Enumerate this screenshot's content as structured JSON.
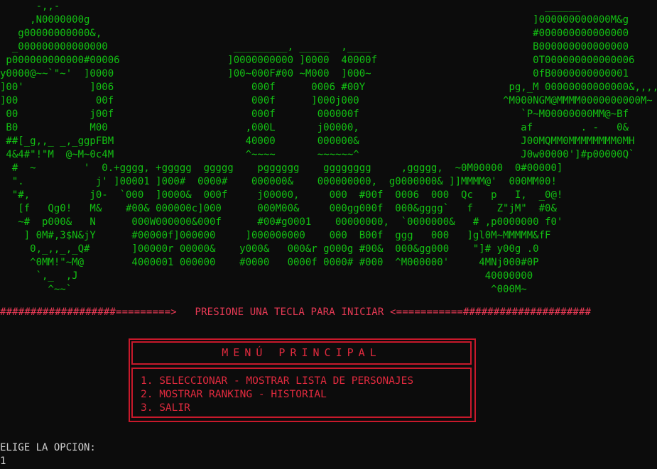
{
  "colors": {
    "background": "#0c0c0c",
    "ascii_art": "#13c013",
    "banner": "#e83a55",
    "menu": "#e02a3e",
    "prompt": "#d0d0d0"
  },
  "ascii_art": "      -,,-                                                                                 ______\n     ,N0000000g                                                                          ]000000000000M&g\n   g00000000000&,                                                                        #000000000000000\n  _000000000000000                     _________, _____  ,____                           B000000000000000\n p000000000000#00006                  ]0000000000 ]0000  40000f                          0T000000000000006\ny0000@~~`\"~'  ]0000                   ]00~000F#00 ~M000  ]000~                           0fB0000000000001\n]00'           ]006                       000f      0006 #00Y                        pg,_M 00000000000000&,,,,,\n]00             00f                       000f      ]000j000                        ^M000NGM@MMMM0000000000M~\n 00            j00f                       000f       000000f                           `P~M00000000MM@~Bf\n B0            M00                       ,000L       j00000,                           af        . -   0&\n ##[_g,,_ _,_ggpFBM                      40000       000000&                           J00MQMM0MMMMMMMM0MH\n 4&4#\"!\"M  @~M~0c4M                      ^~~~~       ~~~~~~^                           J0w00000']#p00000Q`\n  #  ~        '  0.+gggg, +ggggg  ggggg    pgggggg    gggggggg     ,ggggg,  ~0M00000  0#00000]\n  \".            j' ]00001 ]000#  0000#    000000&    000000000,  g0000000& ]]MMMM@'  000MM00!\n  \"#,          j0-  `000  ]0000&  000f     j00000,     000  #00f  0006  000  Qc   p   I,  _0@!\n   [f   Qg0!   M&    #00& 000000c]000      000M00&     000gg000f  000&gggg`   f    Z\"jM\"  #0&\n   ~#  p000&   N      000W000000&000f      #00#g0001    00000000,  `0000000&   # ,p0000000 f0'\n    ] 0M#,3$N&jY      #00000f]000000     ]000000000    000  B00f  ggg   000   ]gl0M~MMMMM&fF\n     0,_,,_,_Q#       ]00000r 00000&    y000&   000&r g000g #00&  000&gg000    \"]# y00g .0\n     ^0MM!\"~M@        4000001 000000    #0000   0000f 0000# #000  ^M000000'     4MNj000#0P\n      `,_  ,J                                                                    40000000\n        ^~~`                                                                      ^000M~",
  "banner": "###################=========>   PRESIONE UNA TECLA PARA INICIAR <===========#####################",
  "menu": {
    "title": "MENÚ PRINCIPAL",
    "items": [
      "1. SELECCIONAR - MOSTRAR LISTA DE PERSONAJES",
      "2. MOSTRAR RANKING - HISTORIAL",
      "3. SALIR"
    ]
  },
  "prompt": "ELIGE LA OPCION:",
  "input_value": "1"
}
